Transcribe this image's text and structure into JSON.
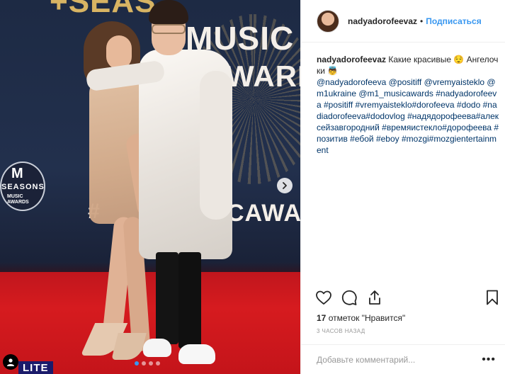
{
  "photo": {
    "backdrop_top": "+SEAS",
    "backdrop_music": "MUSIC",
    "backdrop_awards": "AWARDS",
    "backdrop_hash": "#",
    "backdrop_cawa": "CAWA",
    "seasons_logo": {
      "glyph": "M",
      "line1": "SEASONS",
      "line2": "MUSIC AWARDS"
    },
    "lite_badge": "LITE",
    "carousel": {
      "count": 4,
      "active_index": 0
    },
    "accent_color": "#3897f0"
  },
  "header": {
    "username": "nadyadorofeevaz",
    "bullet": "•",
    "follow_label": "Подписаться"
  },
  "caption": {
    "username": "nadyadorofeevaz",
    "text": "Какие красивые 😌 Ангелочки 👼",
    "tags": "@nadyadorofeeva @positiff @vremyaisteklo @m1ukraine @m1_musicawards #nadyadorofeeva #positiff #vremyaisteklo#dorofeeva #dodo #nadiadorofeeva#dodovlog #надядорофеева#алексейзавгородний #времяистекло#дорофеева #позитив #ебой #eboy #mozgi#mozgientertainment"
  },
  "actions": {
    "like": "heart-icon",
    "comment": "comment-icon",
    "share": "share-icon",
    "save": "bookmark-icon"
  },
  "likes": {
    "count": "17",
    "label": "отметок \"Нравится\""
  },
  "timestamp": "3 ЧАСОВ НАЗАД",
  "comment_box": {
    "placeholder": "Добавьте комментарий...",
    "more": "•••"
  }
}
